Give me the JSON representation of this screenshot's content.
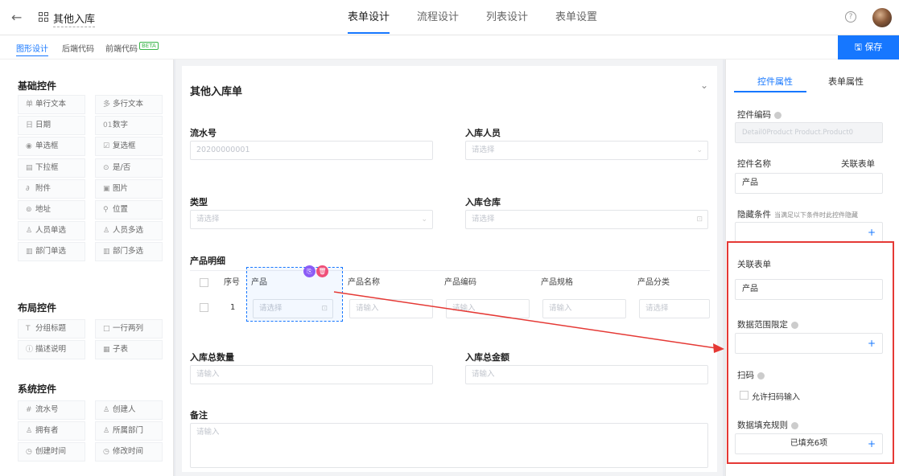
{
  "header": {
    "back_icon": "arrow-left-icon",
    "app_icon": "grid-icon",
    "title": "其他入库",
    "tabs": [
      {
        "label": "表单设计",
        "active": true
      },
      {
        "label": "流程设计",
        "active": false
      },
      {
        "label": "列表设计",
        "active": false
      },
      {
        "label": "表单设置",
        "active": false
      }
    ],
    "help_icon": "help-icon",
    "avatar": "user-avatar"
  },
  "subbar": {
    "tabs": [
      {
        "label": "图形设计",
        "active": true
      },
      {
        "label": "后端代码",
        "active": false
      },
      {
        "label": "前端代码",
        "badge": "BETA",
        "active": false
      }
    ],
    "save_label": "保存",
    "accent": "#1677ff"
  },
  "left_panel": {
    "sections": [
      {
        "title": "基础控件",
        "items": [
          {
            "icon": "单",
            "label": "单行文本"
          },
          {
            "icon": "多",
            "label": "多行文本"
          },
          {
            "icon": "日",
            "label": "日期"
          },
          {
            "icon": "01",
            "label": "数字"
          },
          {
            "icon": "◉",
            "label": "单选框"
          },
          {
            "icon": "☑",
            "label": "复选框"
          },
          {
            "icon": "▤",
            "label": "下拉框"
          },
          {
            "icon": "⊙",
            "label": "是/否"
          },
          {
            "icon": "∂",
            "label": "附件"
          },
          {
            "icon": "▣",
            "label": "图片"
          },
          {
            "icon": "⊚",
            "label": "地址"
          },
          {
            "icon": "⚲",
            "label": "位置"
          },
          {
            "icon": "♙",
            "label": "人员单选"
          },
          {
            "icon": "♙",
            "label": "人员多选"
          },
          {
            "icon": "▥",
            "label": "部门单选"
          },
          {
            "icon": "▥",
            "label": "部门多选"
          }
        ]
      },
      {
        "title": "布局控件",
        "items": [
          {
            "icon": "T",
            "label": "分组标题"
          },
          {
            "icon": "□",
            "label": "一行两列"
          },
          {
            "icon": "ⓘ",
            "label": "描述说明"
          },
          {
            "icon": "▦",
            "label": "子表"
          }
        ]
      },
      {
        "title": "系统控件",
        "items": [
          {
            "icon": "#",
            "label": "流水号"
          },
          {
            "icon": "♙",
            "label": "创建人"
          },
          {
            "icon": "♙",
            "label": "拥有者"
          },
          {
            "icon": "♙",
            "label": "所属部门"
          },
          {
            "icon": "◷",
            "label": "创建时间"
          },
          {
            "icon": "◷",
            "label": "修改时间"
          }
        ]
      }
    ]
  },
  "form": {
    "title": "其他入库单",
    "fields": {
      "serial": {
        "label": "流水号",
        "value": "20200000001"
      },
      "person": {
        "label": "入库人员",
        "placeholder": "请选择"
      },
      "type": {
        "label": "类型",
        "placeholder": "请选择"
      },
      "warehouse": {
        "label": "入库仓库",
        "placeholder": "请选择"
      },
      "detail": {
        "label": "产品明细"
      },
      "total_qty": {
        "label": "入库总数量",
        "placeholder": "请输入"
      },
      "total_amount": {
        "label": "入库总金额",
        "placeholder": "请输入"
      },
      "remark": {
        "label": "备注",
        "placeholder": "请输入"
      }
    },
    "table": {
      "columns": [
        "序号",
        "产品",
        "产品名称",
        "产品编码",
        "产品规格",
        "产品分类"
      ],
      "row": {
        "index": "1",
        "product_placeholder": "请选择",
        "name_placeholder": "请输入",
        "code_placeholder": "请输入",
        "spec_placeholder": "请输入",
        "category_placeholder": "请选择"
      }
    }
  },
  "right_panel": {
    "tabs": [
      {
        "label": "控件属性",
        "active": true
      },
      {
        "label": "表单属性",
        "active": false
      }
    ],
    "control_code": {
      "label": "控件编码",
      "value": "Detail0Product Product.Product0"
    },
    "control_name": {
      "label": "控件名称",
      "link": "关联表单",
      "value": "产品"
    },
    "hide_condition": {
      "label": "隐藏条件",
      "hint": "当满足以下条件时此控件隐藏"
    },
    "related_form": {
      "label": "关联表单",
      "value": "产品"
    },
    "data_range": {
      "label": "数据范围限定"
    },
    "scan": {
      "label": "扫码",
      "option": "允许扫码输入"
    },
    "fill_rule": {
      "label": "数据填充规则",
      "value": "已填充6项"
    },
    "highlight_color": "#e53935"
  }
}
